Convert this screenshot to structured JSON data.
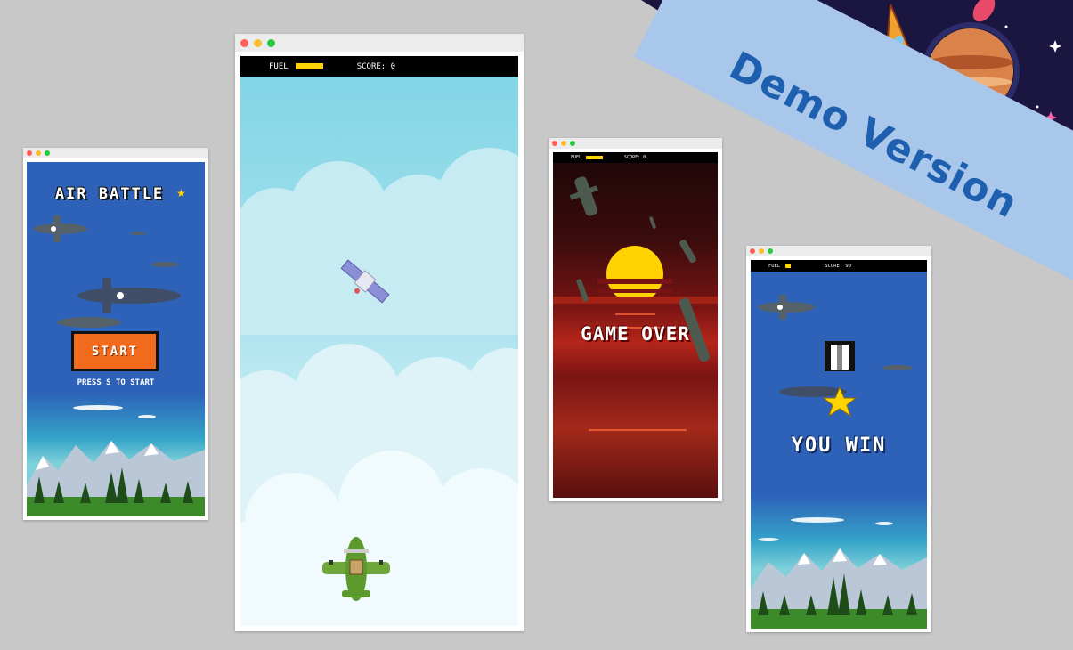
{
  "banner": {
    "text": "Demo Version"
  },
  "window1": {
    "title": "AIR BATTLE",
    "start_label": "START",
    "press_hint": "PRESS S TO START"
  },
  "window2": {
    "hud": {
      "fuel_label": "FUEL",
      "score_label": "SCORE: 0"
    }
  },
  "window3": {
    "hud": {
      "fuel_label": "FUEL",
      "score_label": "SCORE: 0"
    },
    "message": "GAME OVER"
  },
  "window4": {
    "hud": {
      "fuel_label": "FUEL",
      "score_label": "SCORE: 90"
    },
    "message": "YOU WIN"
  },
  "colors": {
    "background": "#c8c8c8",
    "sky_blue": "#2e62b8",
    "fuel": "#ffd400",
    "start_button": "#f26a1b",
    "banner": "#a8c7ea",
    "banner_text": "#1f5fb0",
    "space": "#1b1640"
  },
  "fuel_levels": {
    "window2": 0.55,
    "window3": 0.6,
    "window4": 0.25
  }
}
